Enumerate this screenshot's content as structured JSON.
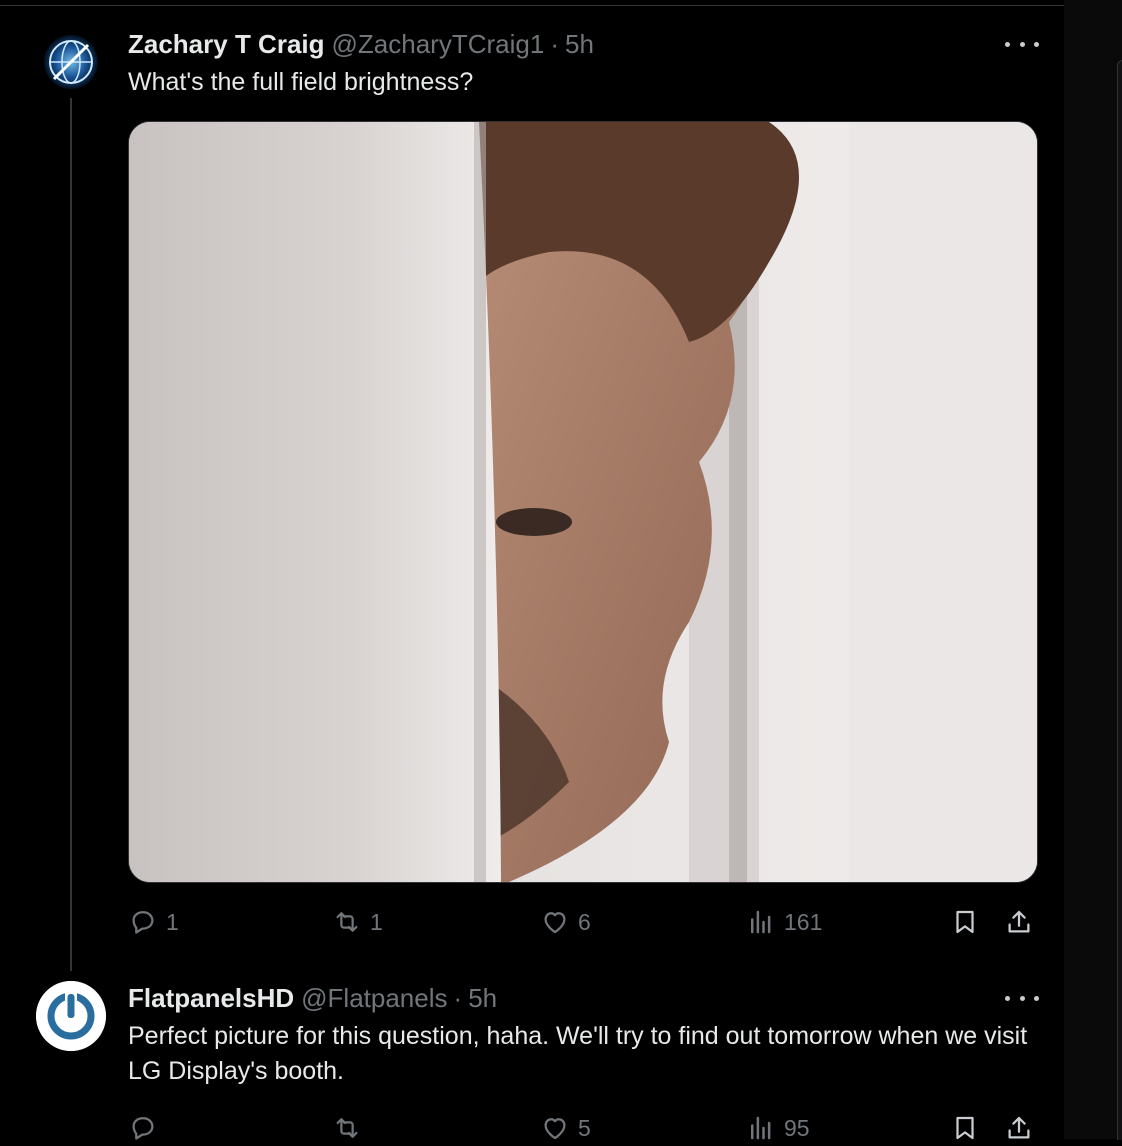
{
  "tweets": [
    {
      "name": "Zachary T Craig",
      "handle": "@ZacharyTCraig1",
      "separator": "·",
      "time": "5h",
      "text": "What's the full field brightness?",
      "media": "photo-man-peeking-behind-door",
      "stats": {
        "replies": "1",
        "reposts": "1",
        "likes": "6",
        "views": "161"
      }
    },
    {
      "name": "FlatpanelsHD",
      "handle": "@Flatpanels",
      "separator": "·",
      "time": "5h",
      "text": "Perfect picture for this question, haha. We'll try to find out tomorrow when we visit LG Display's booth.",
      "stats": {
        "replies": "",
        "reposts": "",
        "likes": "5",
        "views": "95"
      }
    }
  ],
  "icons": {
    "reply": "reply-icon",
    "repost": "repost-icon",
    "like": "heart-icon",
    "views": "views-icon",
    "bookmark": "bookmark-icon",
    "share": "share-icon",
    "more": "more-icon"
  },
  "colors": {
    "background": "#000000",
    "text": "#e7e9ea",
    "secondary": "#71767b",
    "border": "#2f3336",
    "flatpanels_logo": "#2a6ea0"
  }
}
